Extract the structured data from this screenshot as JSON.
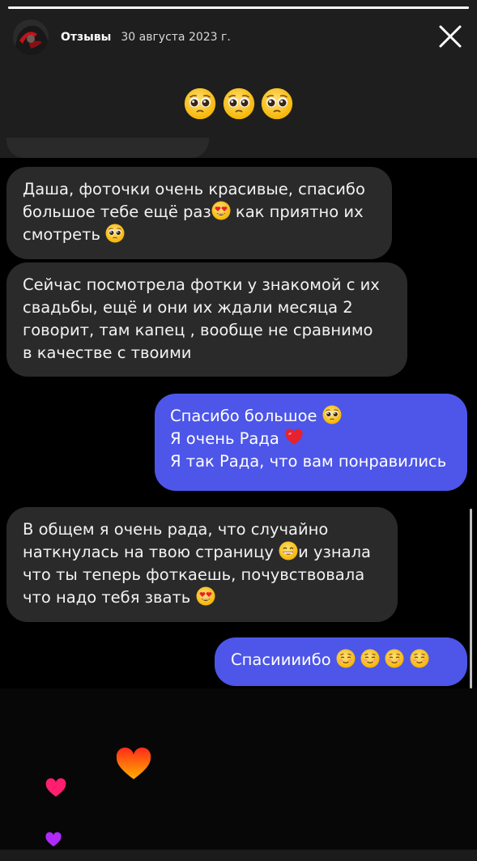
{
  "story": {
    "progress": 1.0,
    "title": "Отзывы",
    "date": "30 августа 2023 г."
  },
  "icons": {
    "close": "close-icon",
    "avatar": "avatar-photo",
    "pleading": "pleading-face-emoji",
    "heart_eyes": "heart-eyes-emoji",
    "red_heart": "red-heart-emoji",
    "grin": "grinning-face-emoji",
    "blush": "smiling-face-emoji"
  },
  "chat": {
    "top_emojis": "🥺🥺🥺",
    "messages": [
      {
        "from": "them",
        "lines": [
          "Даша, фоточки очень красивые, спасибо",
          "большое тебе ещё раз",
          " как приятно их",
          "смотреть "
        ]
      },
      {
        "from": "them",
        "lines": [
          "Сейчас посмотрела фотки у знакомой с их",
          "свадьбы, ещё и они их ждали месяца 2",
          "говорит, там капец , вообще не сравнимо",
          "в качестве с твоими"
        ]
      },
      {
        "from": "me",
        "lines": [
          "Спасибо большое ",
          "Я очень Рада ",
          "Я так Рада, что вам понравились"
        ]
      },
      {
        "from": "them",
        "lines": [
          "В общем я очень рада, что случайно",
          "наткнулась на твою страницу ",
          "и узнала",
          "что ты теперь фоткаешь, почувствовала",
          "что надо тебя звать "
        ]
      },
      {
        "from": "me",
        "lines": [
          "Спасиииибо "
        ]
      }
    ]
  },
  "colors": {
    "outgoing": "#4d56e8",
    "incoming": "#2a2a2a",
    "background": "#000000"
  }
}
